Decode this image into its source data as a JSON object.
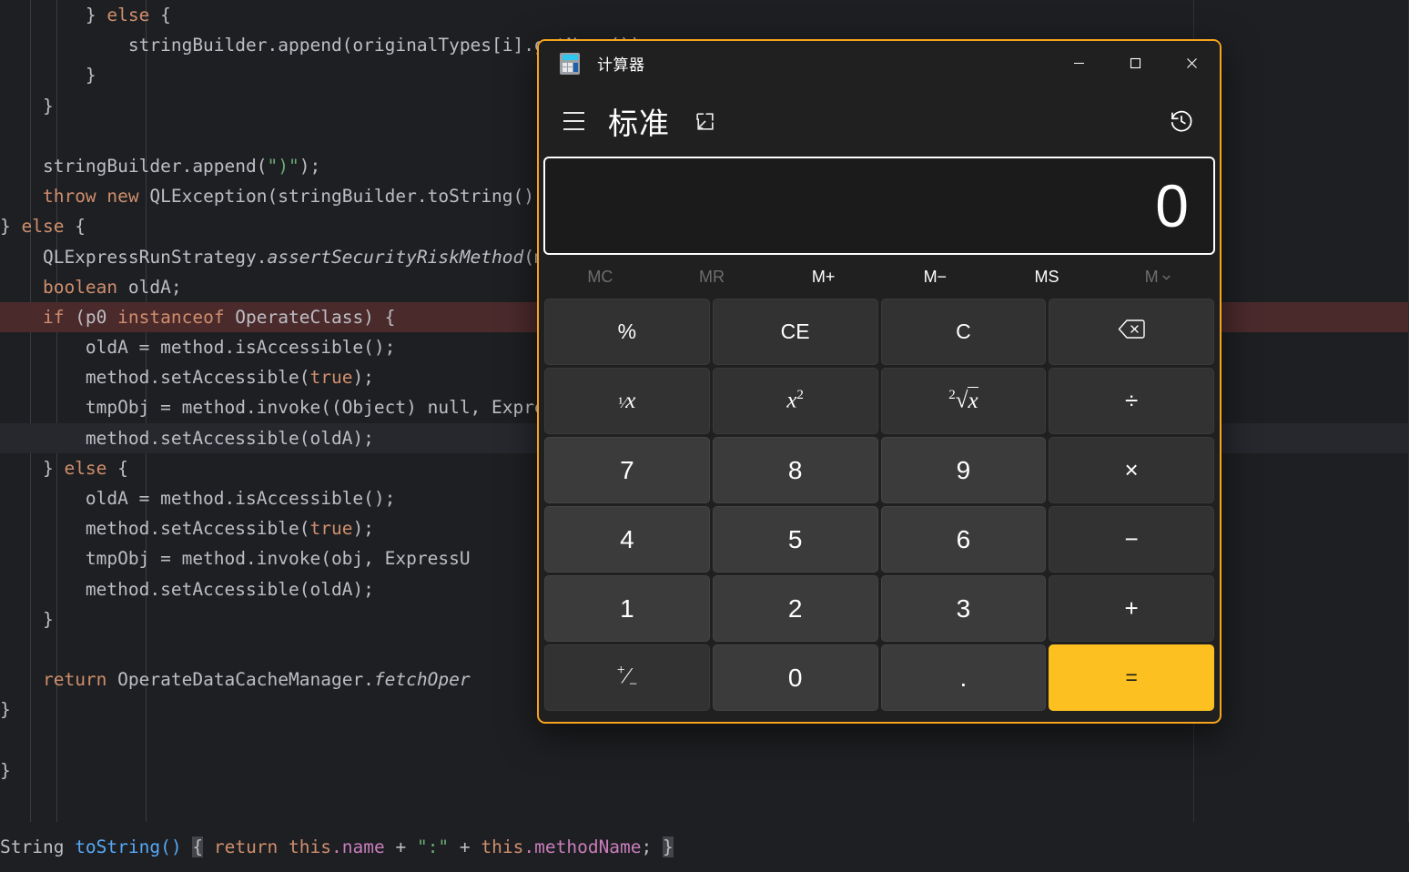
{
  "editor": {
    "language": "java",
    "lines": [
      {
        "indent": 0,
        "segments": [
          {
            "t": "        } ",
            "c": "plain"
          },
          {
            "t": "else",
            "c": "kw"
          },
          {
            "t": " {",
            "c": "plain"
          }
        ]
      },
      {
        "indent": 0,
        "segments": [
          {
            "t": "            stringBuilder.append(originalTypes[i].getName());",
            "c": "plain"
          }
        ]
      },
      {
        "indent": 0,
        "segments": [
          {
            "t": "        }",
            "c": "plain"
          }
        ]
      },
      {
        "indent": 0,
        "segments": [
          {
            "t": "    }",
            "c": "plain"
          }
        ]
      },
      {
        "indent": 0,
        "segments": [
          {
            "t": "",
            "c": "plain"
          }
        ]
      },
      {
        "indent": 0,
        "segments": [
          {
            "t": "    stringBuilder.append(",
            "c": "plain"
          },
          {
            "t": "\")\"",
            "c": "str"
          },
          {
            "t": ");",
            "c": "plain"
          }
        ]
      },
      {
        "indent": 0,
        "segments": [
          {
            "t": "    ",
            "c": "plain"
          },
          {
            "t": "throw new",
            "c": "kw"
          },
          {
            "t": " QLException(stringBuilder.toString());",
            "c": "plain"
          }
        ]
      },
      {
        "indent": 0,
        "segments": [
          {
            "t": "} ",
            "c": "plain"
          },
          {
            "t": "else",
            "c": "kw"
          },
          {
            "t": " {",
            "c": "plain"
          }
        ]
      },
      {
        "indent": 0,
        "segments": [
          {
            "t": "    QLExpressRunStrategy.",
            "c": "plain"
          },
          {
            "t": "assertSecurityRiskMethod",
            "c": "ital"
          },
          {
            "t": "(method);",
            "c": "plain"
          }
        ]
      },
      {
        "indent": 0,
        "segments": [
          {
            "t": "    ",
            "c": "plain"
          },
          {
            "t": "boolean",
            "c": "kw"
          },
          {
            "t": " oldA;",
            "c": "plain"
          }
        ]
      },
      {
        "indent": 0,
        "highlight": "red",
        "segments": [
          {
            "t": "    ",
            "c": "plain"
          },
          {
            "t": "if",
            "c": "kw"
          },
          {
            "t": " (p0 ",
            "c": "plain"
          },
          {
            "t": "instanceof",
            "c": "kw"
          },
          {
            "t": " OperateClass) {",
            "c": "plain"
          }
        ]
      },
      {
        "indent": 0,
        "segments": [
          {
            "t": "        oldA = method.isAccessible();",
            "c": "plain"
          }
        ]
      },
      {
        "indent": 0,
        "segments": [
          {
            "t": "        method.setAccessible(",
            "c": "plain"
          },
          {
            "t": "true",
            "c": "kw"
          },
          {
            "t": ");",
            "c": "plain"
          }
        ]
      },
      {
        "indent": 0,
        "segments": [
          {
            "t": "        tmpObj = method.invoke((Object) null, Express",
            "c": "plain"
          }
        ]
      },
      {
        "indent": 0,
        "highlight": "soft",
        "segments": [
          {
            "t": "        method.setAccessible(oldA);",
            "c": "plain"
          }
        ]
      },
      {
        "indent": 0,
        "segments": [
          {
            "t": "    } ",
            "c": "plain"
          },
          {
            "t": "else",
            "c": "kw"
          },
          {
            "t": " {",
            "c": "plain"
          }
        ]
      },
      {
        "indent": 0,
        "segments": [
          {
            "t": "        oldA = method.isAccessible();",
            "c": "plain"
          }
        ]
      },
      {
        "indent": 0,
        "segments": [
          {
            "t": "        method.setAccessible(",
            "c": "plain"
          },
          {
            "t": "true",
            "c": "kw"
          },
          {
            "t": ");",
            "c": "plain"
          }
        ]
      },
      {
        "indent": 0,
        "segments": [
          {
            "t": "        tmpObj = method.invoke(obj, ExpressU",
            "c": "plain"
          }
        ]
      },
      {
        "indent": 0,
        "segments": [
          {
            "t": "        method.setAccessible(oldA);",
            "c": "plain"
          }
        ]
      },
      {
        "indent": 0,
        "segments": [
          {
            "t": "    }",
            "c": "plain"
          }
        ]
      },
      {
        "indent": 0,
        "segments": [
          {
            "t": "",
            "c": "plain"
          }
        ]
      },
      {
        "indent": 0,
        "segments": [
          {
            "t": "    ",
            "c": "plain"
          },
          {
            "t": "return",
            "c": "kw"
          },
          {
            "t": " OperateDataCacheManager.",
            "c": "plain"
          },
          {
            "t": "fetchOper",
            "c": "ital"
          }
        ]
      },
      {
        "indent": 0,
        "segments": [
          {
            "t": "}",
            "c": "plain"
          }
        ]
      },
      {
        "indent": 0,
        "segments": [
          {
            "t": "",
            "c": "plain"
          }
        ]
      },
      {
        "indent": 0,
        "segments": [
          {
            "t": "}",
            "c": "plain"
          }
        ]
      }
    ],
    "bottom_strip": {
      "parts": [
        {
          "t": "String ",
          "c": "b-plain"
        },
        {
          "t": "toString()",
          "c": "b-method"
        },
        {
          "t": " ",
          "c": "b-plain"
        },
        {
          "t": "{",
          "c": "b-brace"
        },
        {
          "t": " ",
          "c": "b-plain"
        },
        {
          "t": "return",
          "c": "b-kw"
        },
        {
          "t": " ",
          "c": "b-plain"
        },
        {
          "t": "this",
          "c": "b-kw"
        },
        {
          "t": ".name",
          "c": "b-field"
        },
        {
          "t": " + ",
          "c": "b-plain"
        },
        {
          "t": "\":\"",
          "c": "b-str"
        },
        {
          "t": " + ",
          "c": "b-plain"
        },
        {
          "t": "this",
          "c": "b-kw"
        },
        {
          "t": ".methodName",
          "c": "b-field"
        },
        {
          "t": "; ",
          "c": "b-plain"
        },
        {
          "t": "}",
          "c": "b-brace"
        }
      ]
    }
  },
  "calculator": {
    "window_title": "计算器",
    "app_icon": "calculator-icon",
    "window_controls": {
      "minimize": "minimize-icon",
      "maximize": "maximize-icon",
      "close": "close-icon"
    },
    "nav": {
      "menu_icon": "hamburger-menu-icon",
      "mode_label": "标准",
      "keep_on_top_icon": "keep-on-top-icon",
      "history_icon": "history-icon"
    },
    "display": {
      "value": "0"
    },
    "memory_row": [
      {
        "label": "MC",
        "enabled": false
      },
      {
        "label": "MR",
        "enabled": false
      },
      {
        "label": "M+",
        "enabled": true
      },
      {
        "label": "M−",
        "enabled": true
      },
      {
        "label": "MS",
        "enabled": true
      },
      {
        "label": "M",
        "enabled": false,
        "chevron": true
      }
    ],
    "keypad": [
      {
        "label": "%",
        "type": "function",
        "name": "percent-button"
      },
      {
        "label": "CE",
        "type": "function",
        "name": "clear-entry-button"
      },
      {
        "label": "C",
        "type": "function",
        "name": "clear-button"
      },
      {
        "label": "⌫",
        "type": "function",
        "name": "backspace-button",
        "icon": "backspace-icon"
      },
      {
        "label": "¹⁄x",
        "type": "function",
        "name": "reciprocal-button",
        "math": true
      },
      {
        "label": "x²",
        "type": "function",
        "name": "square-button",
        "math": true
      },
      {
        "label": "²√x",
        "type": "function",
        "name": "square-root-button",
        "math": true
      },
      {
        "label": "÷",
        "type": "function",
        "name": "divide-button",
        "op": true
      },
      {
        "label": "7",
        "type": "digit",
        "name": "digit-7-button"
      },
      {
        "label": "8",
        "type": "digit",
        "name": "digit-8-button"
      },
      {
        "label": "9",
        "type": "digit",
        "name": "digit-9-button"
      },
      {
        "label": "×",
        "type": "function",
        "name": "multiply-button",
        "op": true
      },
      {
        "label": "4",
        "type": "digit",
        "name": "digit-4-button"
      },
      {
        "label": "5",
        "type": "digit",
        "name": "digit-5-button"
      },
      {
        "label": "6",
        "type": "digit",
        "name": "digit-6-button"
      },
      {
        "label": "−",
        "type": "function",
        "name": "subtract-button",
        "op": true
      },
      {
        "label": "1",
        "type": "digit",
        "name": "digit-1-button"
      },
      {
        "label": "2",
        "type": "digit",
        "name": "digit-2-button"
      },
      {
        "label": "3",
        "type": "digit",
        "name": "digit-3-button"
      },
      {
        "label": "+",
        "type": "function",
        "name": "add-button",
        "op": true
      },
      {
        "label": "⁺∕₋",
        "type": "function",
        "name": "negate-button",
        "math": true
      },
      {
        "label": "0",
        "type": "digit",
        "name": "digit-0-button"
      },
      {
        "label": ".",
        "type": "digit",
        "name": "decimal-point-button"
      },
      {
        "label": "=",
        "type": "equals",
        "name": "equals-button"
      }
    ]
  },
  "colors": {
    "accent_border": "#f7a41d",
    "equals_background": "#fcc021",
    "window_background": "#202020",
    "key_function": "#323232",
    "key_digit": "#3b3b3b",
    "editor_background": "#1e1f22",
    "breakpoint_line": "#4b2a2c",
    "keyword": "#cf8e6d",
    "string": "#6aab73",
    "text": "#bcbec4"
  }
}
